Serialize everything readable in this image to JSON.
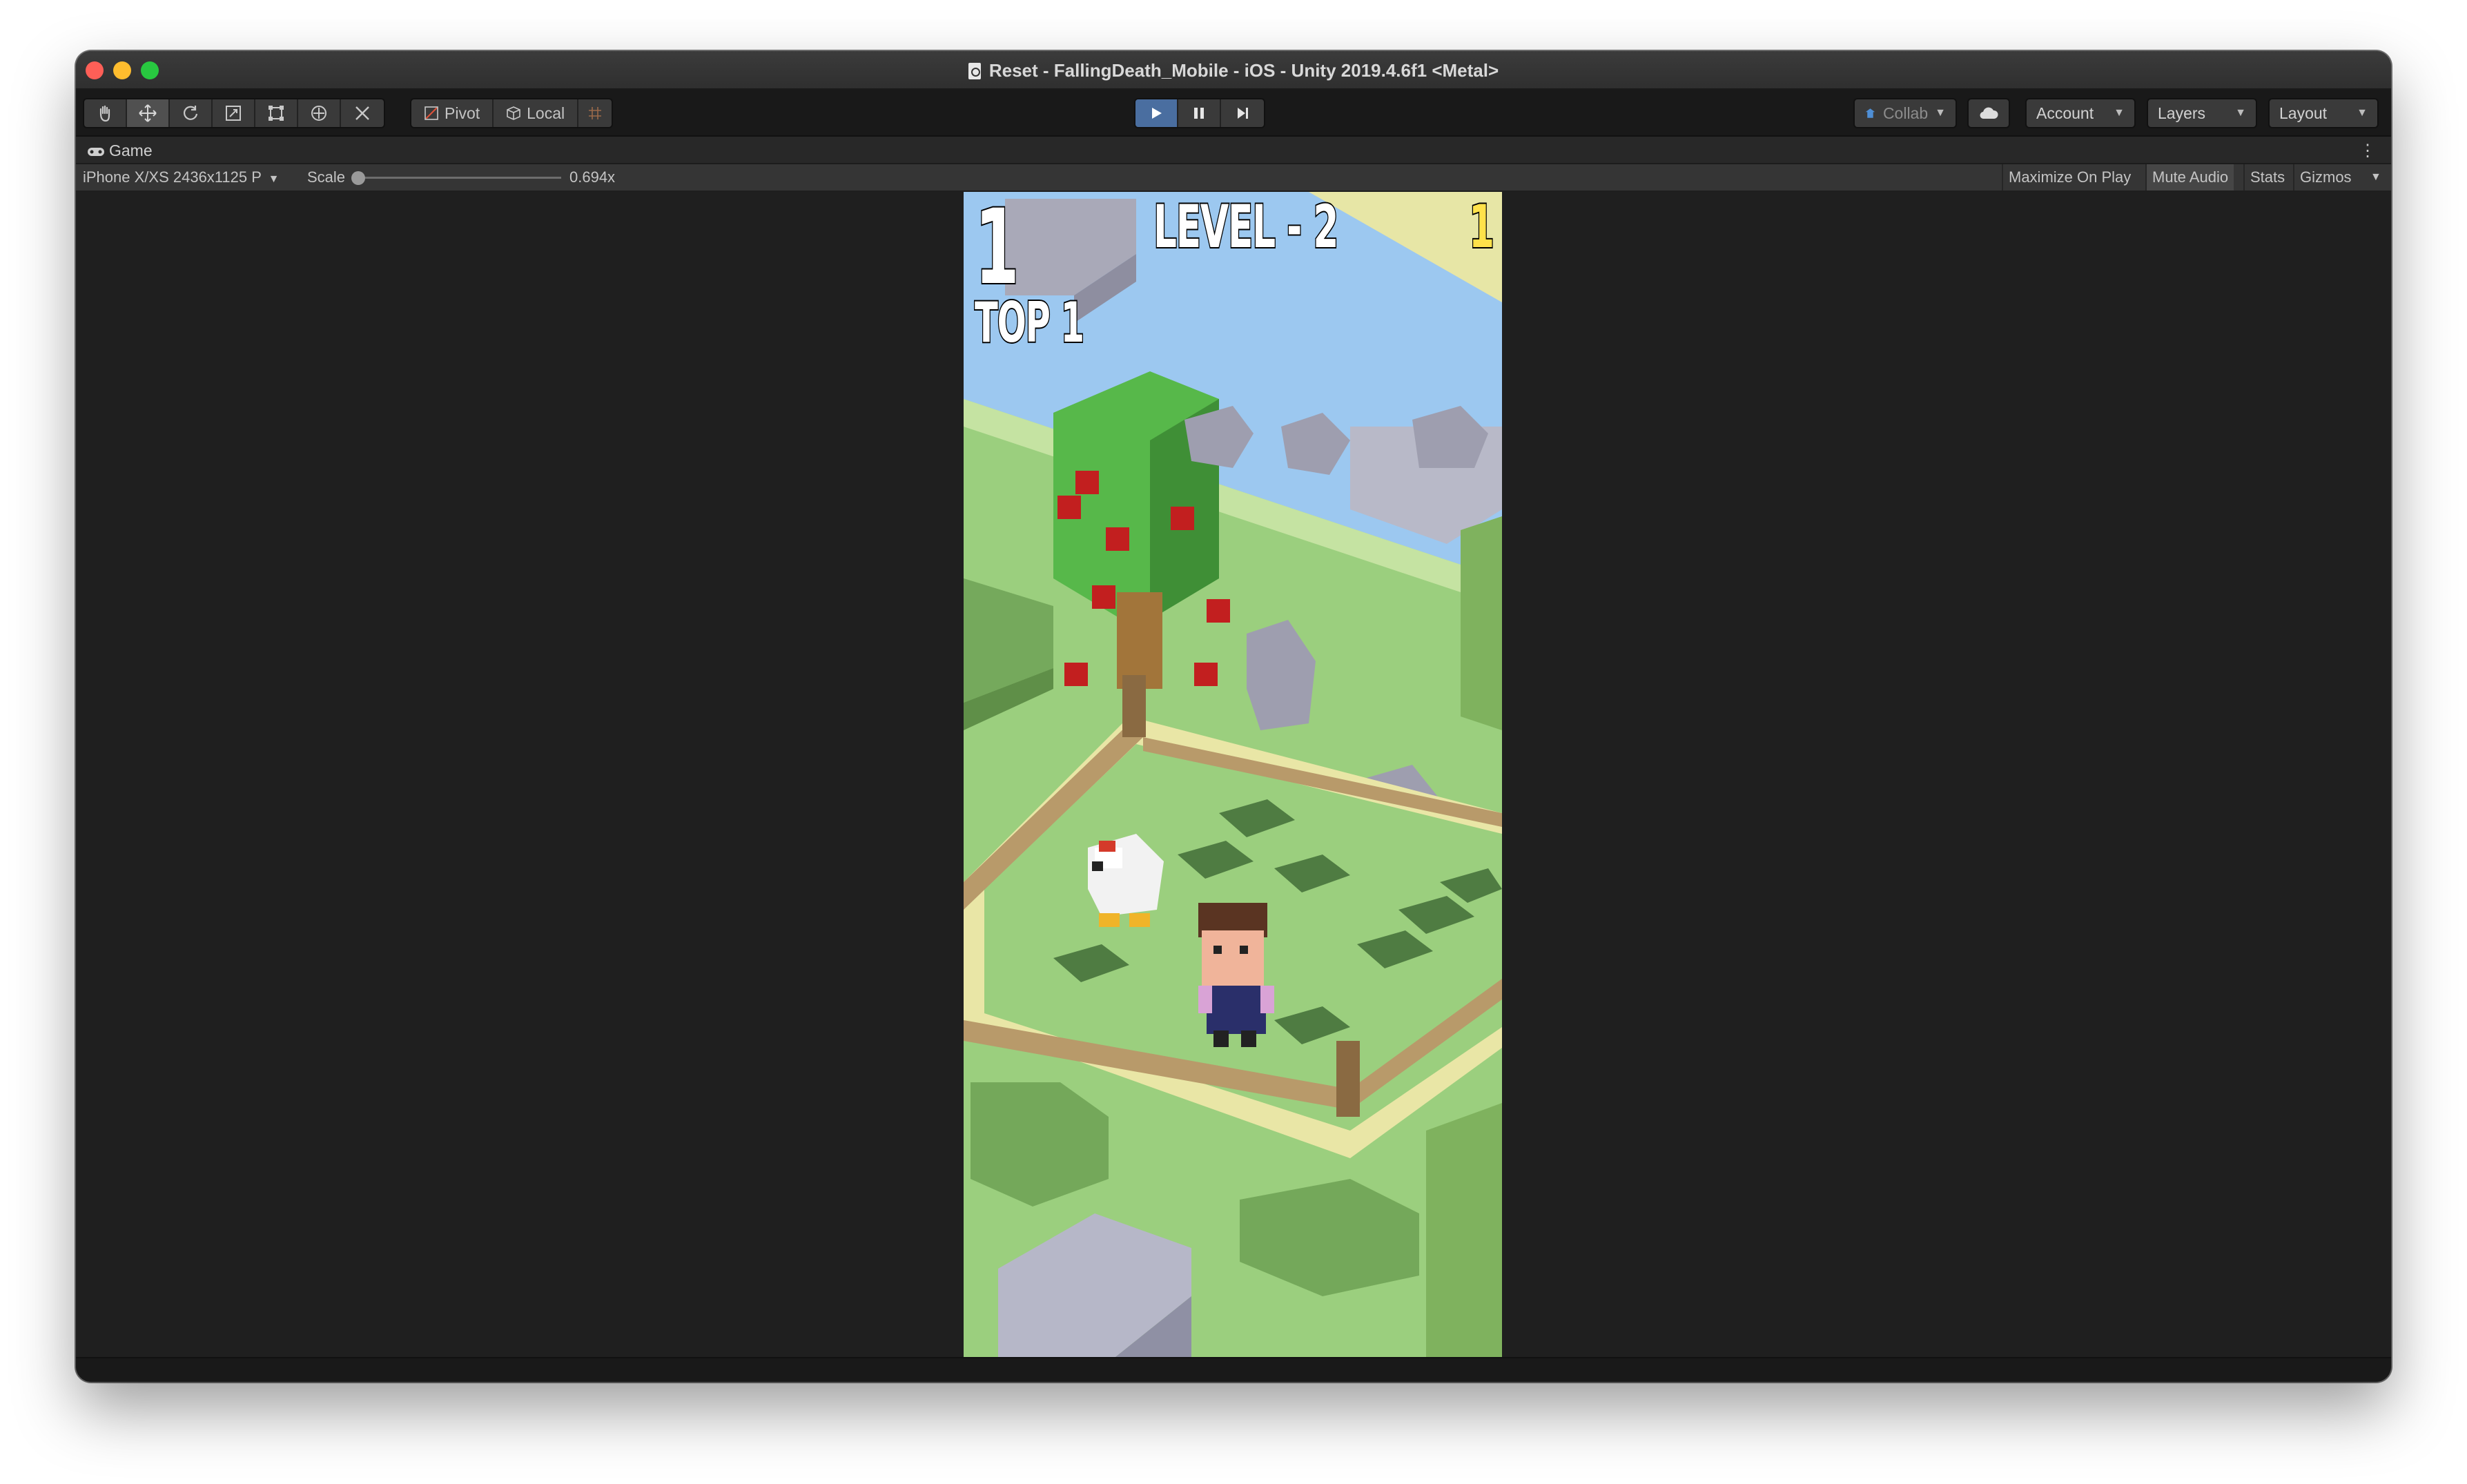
{
  "window": {
    "title": "Reset - FallingDeath_Mobile - iOS - Unity 2019.4.6f1 <Metal>"
  },
  "toolbar": {
    "tools": [
      "hand-tool-icon",
      "move-tool-icon",
      "rotate-tool-icon",
      "scale-tool-icon",
      "rect-tool-icon",
      "transform-tool-icon",
      "custom-tool-icon"
    ],
    "pivot_label": "Pivot",
    "local_label": "Local",
    "collab_label": "Collab",
    "account_label": "Account",
    "layers_label": "Layers",
    "layout_label": "Layout"
  },
  "game_tab": {
    "label": "Game"
  },
  "game_bar": {
    "resolution": "iPhone X/XS 2436x1125 P",
    "scale_label": "Scale",
    "scale_value": "0.694x",
    "scale_fraction": 0.0,
    "maximize_label": "Maximize On Play",
    "mute_label": "Mute Audio",
    "stats_label": "Stats",
    "gizmos_label": "Gizmos"
  },
  "hud": {
    "score": "1",
    "top": "TOP 1",
    "level": "LEVEL - 2",
    "coins": "1"
  },
  "colors": {
    "accent_play": "#4a6ea0",
    "sky": "#9cc8f0",
    "grass": "#9bcf7e",
    "coin": "#ffe24a"
  }
}
